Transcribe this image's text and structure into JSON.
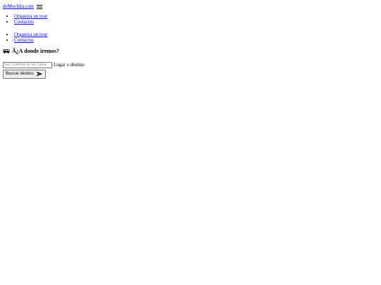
{
  "header": {
    "brand": "deMochila.com",
    "menu_icon": "hamburger-menu-icon"
  },
  "nav_primary": {
    "items": [
      {
        "label": "Organiza un tour"
      },
      {
        "label": "Contactos"
      }
    ]
  },
  "nav_secondary": {
    "items": [
      {
        "label": "Organiza un tour"
      },
      {
        "label": "Contactos"
      }
    ]
  },
  "hero": {
    "icon": "bus-icon",
    "title": "Â¿A donde iremos?"
  },
  "search": {
    "input_placeholder": "San Cristobal de las Casas",
    "input_label": "Lugar o destino",
    "button_label": "Buscar destino",
    "button_icon": "send-icon"
  }
}
